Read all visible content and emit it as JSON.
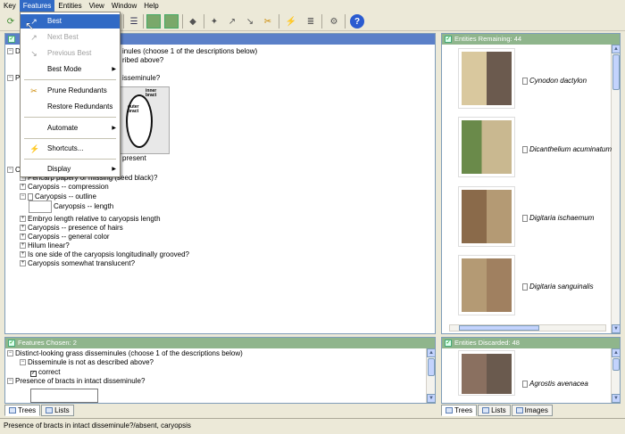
{
  "menubar": {
    "items": [
      "Key",
      "Features",
      "Entities",
      "View",
      "Window",
      "Help"
    ]
  },
  "features_menu": {
    "items": [
      {
        "label": "Best",
        "icon": "best-icon",
        "state": "highlighted"
      },
      {
        "label": "Next Best",
        "icon": "next-best-icon",
        "state": "disabled"
      },
      {
        "label": "Previous Best",
        "icon": "previous-best-icon",
        "state": "disabled"
      },
      {
        "label": "Best Mode",
        "submenu": true
      },
      {
        "label": "Prune Redundants",
        "icon": "prune-icon"
      },
      {
        "label": "Restore Redundants"
      },
      {
        "label": "Automate",
        "submenu": true
      },
      {
        "label": "Shortcuts...",
        "icon": "shortcuts-icon"
      },
      {
        "label": "Display",
        "submenu": true
      }
    ]
  },
  "features_available": {
    "rows": {
      "r0": "inules (choose 1 of the descriptions below)",
      "r1": "ribed above?",
      "r2": "isseminule?",
      "present_label": "present",
      "inner_bract": "inner bract",
      "outer_bract": "outer bract",
      "r4": "Pericarp papery or missing (seed black)?",
      "r5": "Caryopsis -- compression",
      "r6": "Caryopsis -- outline",
      "r7": "Caryopsis -- length",
      "r8": "Embryo length relative to caryopsis length",
      "r9": "Caryopsis -- presence of hairs",
      "r10": "Caryopsis -- general color",
      "r11": "Hilum linear?",
      "r12": "Is one side of the caryopsis longitudinally grooved?",
      "r13": "Caryopsis somewhat translucent?",
      "left_clip_1": "D",
      "left_clip_2": "P",
      "left_clip_3": "C"
    }
  },
  "features_chosen": {
    "title": "Features Chosen: 2",
    "rows": [
      "Distinct-looking grass disseminules (choose 1 of the descriptions below)",
      "Disseminule is not as described above?",
      "correct",
      "Presence of bracts in intact disseminule?"
    ]
  },
  "left_tabs": {
    "trees": "Trees",
    "lists": "Lists"
  },
  "entities_remaining": {
    "title": "Entities Remaining: 44",
    "items": [
      "Cynodon dactylon",
      "Dicanthelium acuminatum",
      "Digitaria ischaemum",
      "Digitaria sanguinalis"
    ]
  },
  "entities_discarded": {
    "title": "Entities Discarded: 48",
    "items": [
      "Agrostis avenacea"
    ]
  },
  "right_tabs": {
    "trees": "Trees",
    "lists": "Lists",
    "images": "Images"
  },
  "status": "Presence of bracts in intact disseminule?/absent, caryopsis",
  "colors": {
    "title_blue": "#5b80c8",
    "title_green": "#8fb58c",
    "menu_highlight": "#316ac5"
  }
}
